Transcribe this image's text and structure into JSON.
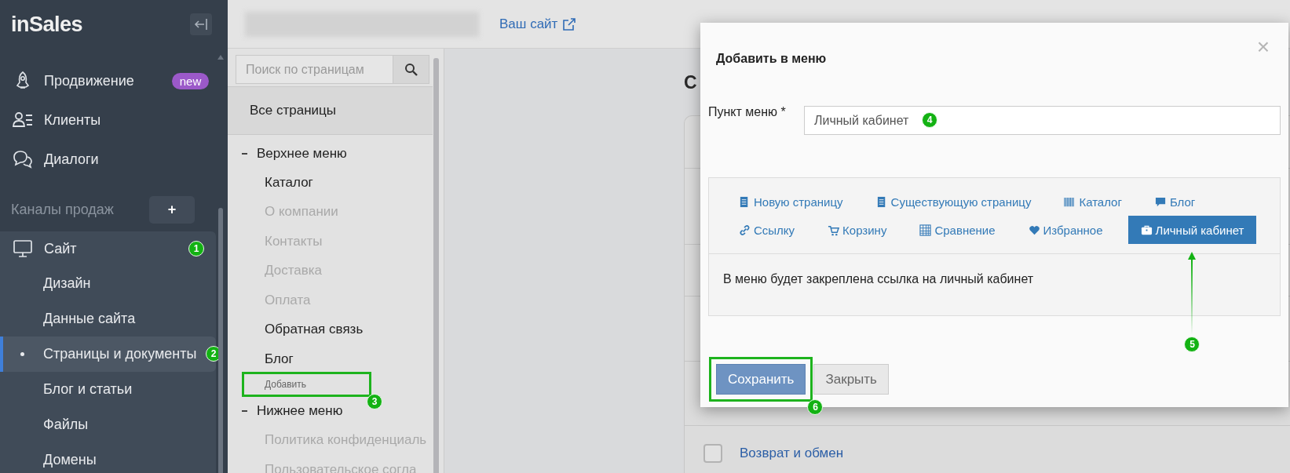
{
  "sidebar": {
    "logo": "inSales",
    "nav": [
      {
        "label": "Продвижение",
        "badge": "new"
      },
      {
        "label": "Клиенты"
      },
      {
        "label": "Диалоги"
      }
    ],
    "section": {
      "title": "Каналы продаж",
      "add_button": "+"
    },
    "site": {
      "label": "Сайт",
      "marker": "1",
      "children": [
        {
          "label": "Дизайн",
          "selected": false
        },
        {
          "label": "Данные сайта",
          "selected": false
        },
        {
          "label": "Страницы и документы",
          "selected": true,
          "marker": "2"
        },
        {
          "label": "Блог и статьи",
          "selected": false
        },
        {
          "label": "Файлы",
          "selected": false
        },
        {
          "label": "Домены",
          "selected": false
        }
      ]
    }
  },
  "top_bar": {
    "site_link": "Ваш сайт"
  },
  "pages_panel": {
    "search": {
      "placeholder": "Поиск по страницам"
    },
    "all_pages": "Все страницы",
    "menus": [
      {
        "title": "Верхнее меню",
        "expanded": true,
        "children": [
          {
            "label": "Каталог",
            "kind": "page",
            "hidden": false
          },
          {
            "label": "О компании",
            "kind": "page",
            "hidden": true
          },
          {
            "label": "Контакты",
            "kind": "page",
            "hidden": true
          },
          {
            "label": "Доставка",
            "kind": "page",
            "hidden": true
          },
          {
            "label": "Оплата",
            "kind": "page",
            "hidden": true
          },
          {
            "label": "Обратная связь",
            "kind": "page",
            "hidden": false
          },
          {
            "label": "Блог",
            "kind": "page",
            "hidden": false
          },
          {
            "label": "Добавить",
            "kind": "add",
            "highlighted": true,
            "marker": "3"
          }
        ]
      },
      {
        "title": "Нижнее меню",
        "expanded": true,
        "children": [
          {
            "label": "Политика конфиденциаль",
            "kind": "page",
            "hidden": true
          },
          {
            "label": "Пользовательское согла",
            "kind": "page",
            "hidden": true
          }
        ]
      }
    ]
  },
  "main": {
    "heading": "С",
    "rows": [
      {
        "label": "Возврат и обмен",
        "checked": false
      }
    ]
  },
  "dialog": {
    "title": "Добавить в меню",
    "close": "×",
    "field": {
      "label": "Пункт меню *",
      "value": "Личный кабинет",
      "marker": "4"
    },
    "tab_rows": [
      [
        {
          "label": "Новую страницу",
          "kind": "page",
          "selected": false
        },
        {
          "label": "Существующую страницу",
          "kind": "page",
          "selected": false
        },
        {
          "label": "Каталог",
          "kind": "catalog",
          "selected": false
        },
        {
          "label": "Блог",
          "kind": "blog",
          "selected": false
        }
      ],
      [
        {
          "label": "Ссылку",
          "kind": "link",
          "selected": false
        },
        {
          "label": "Корзину",
          "kind": "cart",
          "selected": false
        },
        {
          "label": "Сравнение",
          "kind": "compare",
          "selected": false
        },
        {
          "label": "Избранное",
          "kind": "favorites",
          "selected": false
        },
        {
          "label": "Личный кабинет",
          "kind": "account",
          "selected": true,
          "marker": "5"
        }
      ]
    ],
    "description": "В меню будет закреплена ссылка на личный кабинет",
    "buttons": [
      {
        "label": "Сохранить",
        "kind": "primary",
        "highlighted": true,
        "marker": "6"
      },
      {
        "label": "Закрыть",
        "kind": "default"
      }
    ]
  }
}
